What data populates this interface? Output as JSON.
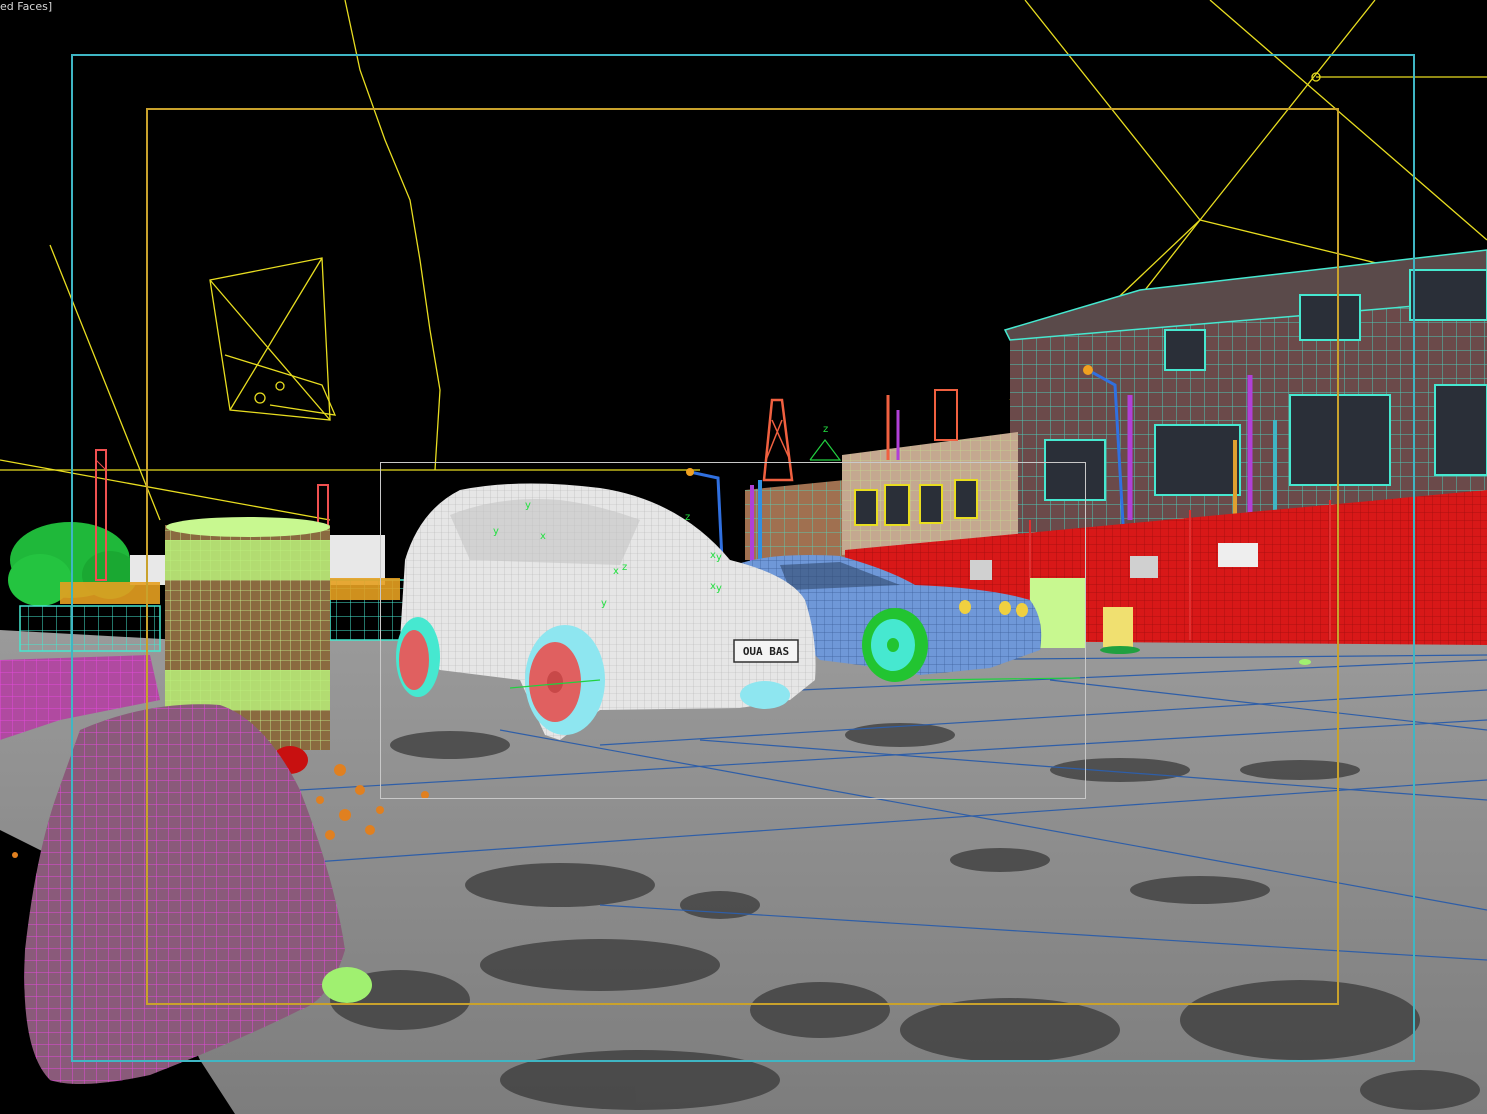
{
  "viewport": {
    "label": "ed Faces]",
    "shading_mode": "wireframe-on-shaded"
  },
  "scene": {
    "license_plate_text": "OUA BAS",
    "sign_text": "",
    "gizmo_labels": [
      "y",
      "z",
      "x",
      "z",
      "y",
      "x",
      "y",
      "x",
      "y",
      "z",
      "y",
      "x"
    ]
  },
  "colors": {
    "background": "#000000",
    "ground": "#8e8e8e",
    "safe_frame_outer": "#3fb6c4",
    "safe_frame_inner": "#c9a22c",
    "region_box": "#c8c8c8",
    "hatchback": "#e6e6e6",
    "sedan": "#6f98d8",
    "wheel_red": "#e06060",
    "wheel_green": "#22c431",
    "barrel_wire": "#b8f07a",
    "rock_wire": "#d040c0",
    "fence": "#d81818",
    "building_wire": "#46e8d0",
    "camera_lines": "#e8dd20"
  }
}
